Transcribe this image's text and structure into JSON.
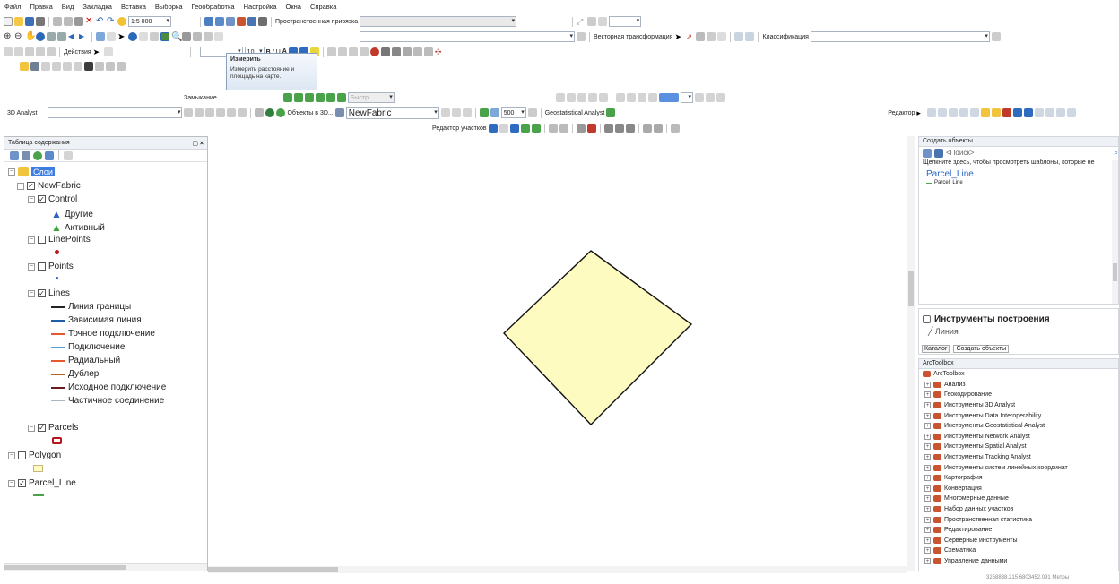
{
  "menu": [
    "Файл",
    "Правка",
    "Вид",
    "Закладка",
    "Вставка",
    "Выборка",
    "Геообработка",
    "Настройка",
    "Окна",
    "Справка"
  ],
  "toolbar": {
    "scale": "1:5 000",
    "spatial_ref": "Пространственная привязка",
    "vector_transform": "Векторная трансформация",
    "classification": "Классификация",
    "actions": "Действия",
    "font_size": "10",
    "closure": "Замыкание",
    "quick": "Быстр",
    "analyst_3d": "3D Analyst",
    "objects_3d": "Объекты в 3D...",
    "fabric": "NewFabric",
    "geostat": "Geostatistical Analyst",
    "zoom": "500",
    "editor": "Редактор",
    "parcel_editor": "Редактор участков",
    "bold": "B",
    "italic": "I",
    "underline": "U",
    "font_color": "A"
  },
  "tooltip": {
    "title": "Измерить",
    "text": "Измерить расстояние и площадь на карте."
  },
  "toc": {
    "title": "Таблица содержания",
    "close": "×",
    "pin": "▢",
    "layers_root": "Слои",
    "newfabric": "NewFabric",
    "control": "Control",
    "other": "Другие",
    "active": "Активный",
    "linepoints": "LinePoints",
    "points": "Points",
    "lines": "Lines",
    "line_items": [
      "Линия границы",
      "Зависимая линия",
      "Точное подключение",
      "Подключение",
      "Радиальный",
      "Дублер",
      "Исходное подключение",
      "Частичное соединение"
    ],
    "line_colors": [
      "#222222",
      "#1f5fa8",
      "#e8582e",
      "#4da3d6",
      "#e8582e",
      "#b8601d",
      "#6b1c1c",
      "#a9b6c4"
    ],
    "parcels": "Parcels",
    "polygon": "Polygon",
    "parcel_line": "Parcel_Line"
  },
  "create": {
    "title": "Создать объекты",
    "search": "<Поиск>",
    "hint": "Щелкните здесь, чтобы просмотреть шаблоны, которые не",
    "group": "Parcel_Line",
    "item": "Parcel_Line",
    "tools_title": "Инструменты построения",
    "line": "Линия",
    "catalog_tab": "Каталог",
    "create_tab": "Создать объекты"
  },
  "arctoolbox": {
    "title": "ArcToolbox",
    "root": "ArcToolbox",
    "items": [
      "Анализ",
      "Геокодирование",
      "Инструменты 3D Analyst",
      "Инструменты Data Interoperability",
      "Инструменты Geostatistical Analyst",
      "Инструменты Network Analyst",
      "Инструменты Spatial Analyst",
      "Инструменты Tracking Analyst",
      "Инструменты систем линейных координат",
      "Картография",
      "Конвертация",
      "Многомерные данные",
      "Набор данных участков",
      "Пространственная статистика",
      "Редактирование",
      "Серверные инструменты",
      "Схематика",
      "Управление данными"
    ]
  },
  "status": "3258838.215  6803452.091 Метры",
  "colors": {
    "parcel_fill": "#fdfbc0",
    "parcel_stroke": "#111111",
    "selected": "#3d7de0",
    "toolbox_icon": "#c9542f"
  }
}
